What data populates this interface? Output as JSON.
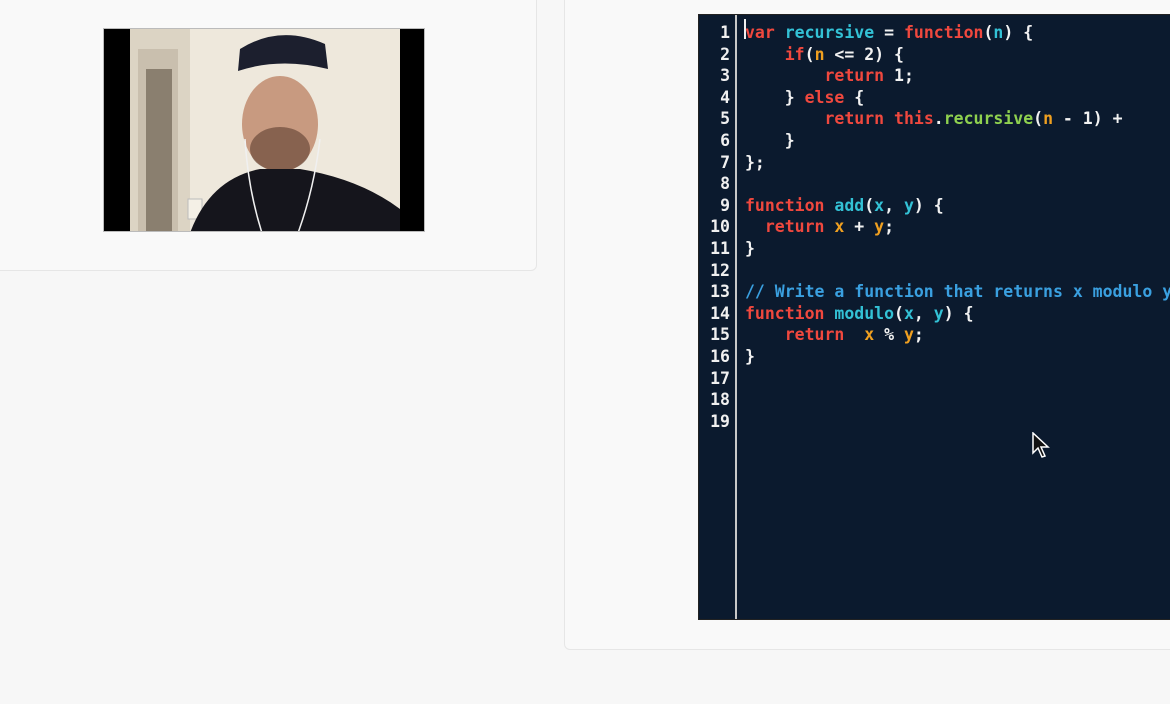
{
  "video": {
    "participant": "webcam-feed"
  },
  "editor": {
    "line_numbers": [
      "1",
      "2",
      "3",
      "4",
      "5",
      "6",
      "7",
      "8",
      "9",
      "10",
      "11",
      "12",
      "13",
      "14",
      "15",
      "16",
      "17",
      "18",
      "19"
    ],
    "lines": [
      [
        {
          "t": "var ",
          "c": "kw"
        },
        {
          "t": "recursive",
          "c": "fn"
        },
        {
          "t": " = ",
          "c": "pun"
        },
        {
          "t": "function",
          "c": "kw"
        },
        {
          "t": "(",
          "c": "pun"
        },
        {
          "t": "n",
          "c": "fn"
        },
        {
          "t": ") {",
          "c": "pun"
        }
      ],
      [
        {
          "t": "    ",
          "c": "pun"
        },
        {
          "t": "if",
          "c": "kw"
        },
        {
          "t": "(",
          "c": "pun"
        },
        {
          "t": "n",
          "c": "prm"
        },
        {
          "t": " <= 2) {",
          "c": "pun"
        }
      ],
      [
        {
          "t": "        ",
          "c": "pun"
        },
        {
          "t": "return",
          "c": "kw"
        },
        {
          "t": " 1;",
          "c": "pun"
        }
      ],
      [
        {
          "t": "    } ",
          "c": "pun"
        },
        {
          "t": "else",
          "c": "kw"
        },
        {
          "t": " {",
          "c": "pun"
        }
      ],
      [
        {
          "t": "        ",
          "c": "pun"
        },
        {
          "t": "return",
          "c": "kw"
        },
        {
          "t": " ",
          "c": "pun"
        },
        {
          "t": "this",
          "c": "kw"
        },
        {
          "t": ".",
          "c": "pun"
        },
        {
          "t": "recursive",
          "c": "mth"
        },
        {
          "t": "(",
          "c": "pun"
        },
        {
          "t": "n",
          "c": "prm"
        },
        {
          "t": " - 1) +",
          "c": "pun"
        }
      ],
      [
        {
          "t": "    }",
          "c": "pun"
        }
      ],
      [
        {
          "t": "};",
          "c": "pun"
        }
      ],
      [],
      [
        {
          "t": "function",
          "c": "kw"
        },
        {
          "t": " ",
          "c": "pun"
        },
        {
          "t": "add",
          "c": "fn"
        },
        {
          "t": "(",
          "c": "pun"
        },
        {
          "t": "x",
          "c": "fn"
        },
        {
          "t": ", ",
          "c": "pun"
        },
        {
          "t": "y",
          "c": "fn"
        },
        {
          "t": ") {",
          "c": "pun"
        }
      ],
      [
        {
          "t": "  ",
          "c": "pun"
        },
        {
          "t": "return",
          "c": "kw"
        },
        {
          "t": " ",
          "c": "pun"
        },
        {
          "t": "x",
          "c": "prm"
        },
        {
          "t": " + ",
          "c": "pun"
        },
        {
          "t": "y",
          "c": "prm"
        },
        {
          "t": ";",
          "c": "pun"
        }
      ],
      [
        {
          "t": "}",
          "c": "pun"
        }
      ],
      [],
      [
        {
          "t": "// Write a function that returns x modulo y",
          "c": "cmt"
        }
      ],
      [
        {
          "t": "function",
          "c": "kw"
        },
        {
          "t": " ",
          "c": "pun"
        },
        {
          "t": "modulo",
          "c": "fn"
        },
        {
          "t": "(",
          "c": "pun"
        },
        {
          "t": "x",
          "c": "fn"
        },
        {
          "t": ", ",
          "c": "pun"
        },
        {
          "t": "y",
          "c": "fn"
        },
        {
          "t": ") {",
          "c": "pun"
        }
      ],
      [
        {
          "t": "    ",
          "c": "pun"
        },
        {
          "t": "return",
          "c": "kw"
        },
        {
          "t": "  ",
          "c": "pun"
        },
        {
          "t": "x",
          "c": "prm"
        },
        {
          "t": " % ",
          "c": "pun"
        },
        {
          "t": "y",
          "c": "prm"
        },
        {
          "t": ";",
          "c": "pun"
        }
      ],
      [
        {
          "t": "}",
          "c": "pun"
        }
      ],
      [],
      [],
      []
    ]
  },
  "colors": {
    "editor_bg": "#0b1a2e",
    "keyword": "#f0483e",
    "function_name": "#33c2d6",
    "param": "#f0a020",
    "method": "#8fd14f",
    "comment": "#3aa0e0",
    "page_bg": "#f7f7f7"
  }
}
